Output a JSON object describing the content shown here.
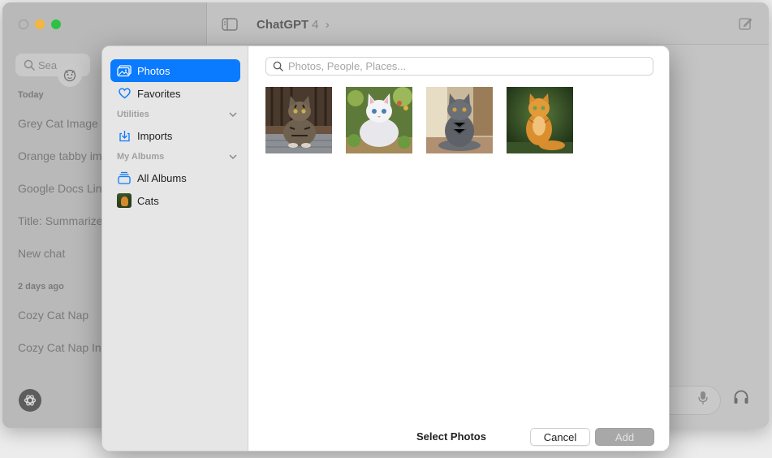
{
  "app": {
    "search_placeholder": "Sea",
    "sections": [
      {
        "label": "Today",
        "items": [
          "Grey Cat Image",
          "Orange tabby im",
          "Google Docs Lin",
          "Title: Summarize",
          "New chat"
        ]
      },
      {
        "label": "2 days ago",
        "items": [
          "Cozy Cat Nap",
          "Cozy Cat Nap In"
        ]
      }
    ],
    "model_name": "ChatGPT",
    "model_version": "4",
    "model_chevron": "›"
  },
  "picker": {
    "nav": {
      "photos": "Photos",
      "favorites": "Favorites",
      "utilities_label": "Utilities",
      "imports": "Imports",
      "my_albums_label": "My Albums",
      "all_albums": "All Albums",
      "cats": "Cats"
    },
    "search_placeholder": "Photos, People, Places...",
    "photos": [
      {
        "name": "tabby-cat-on-wooden-deck"
      },
      {
        "name": "white-fluffy-cat-in-garden"
      },
      {
        "name": "grey-cat-sitting"
      },
      {
        "name": "orange-cat-on-green"
      }
    ],
    "footer_title": "Select Photos",
    "cancel_label": "Cancel",
    "add_label": "Add"
  },
  "colors": {
    "accent": "#0a7aff",
    "traffic_min": "#f5b53f",
    "traffic_max": "#2ec244"
  }
}
